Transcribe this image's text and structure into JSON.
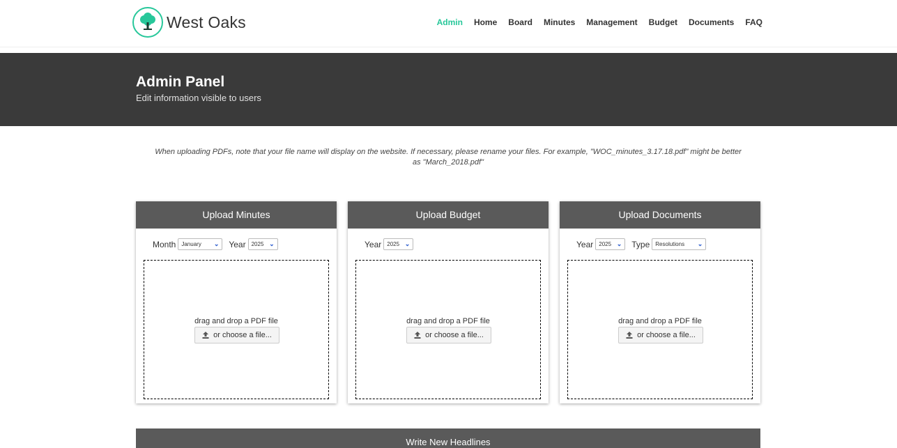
{
  "brand": {
    "name": "West Oaks",
    "accent": "#27c79a"
  },
  "nav": [
    "Admin",
    "Home",
    "Board",
    "Minutes",
    "Management",
    "Budget",
    "Documents",
    "FAQ"
  ],
  "banner": {
    "title": "Admin Panel",
    "subtitle": "Edit information visible to users"
  },
  "notice": "When uploading PDFs, note that your file name will display on the website. If necessary, please rename your files. For example, \"WOC_minutes_3.17.18.pdf\" might be better as \"March_2018.pdf\"",
  "cards": {
    "minutes": {
      "title": "Upload Minutes",
      "month_label": "Month",
      "month_value": "January",
      "year_label": "Year",
      "year_value": "2025"
    },
    "budget": {
      "title": "Upload Budget",
      "year_label": "Year",
      "year_value": "2025"
    },
    "documents": {
      "title": "Upload Documents",
      "year_label": "Year",
      "year_value": "2025",
      "type_label": "Type",
      "type_value": "Resolutions"
    }
  },
  "dropzone": {
    "text": "drag and drop a PDF file",
    "button": "or choose a file..."
  },
  "headlines": {
    "title": "Write New Headlines"
  }
}
